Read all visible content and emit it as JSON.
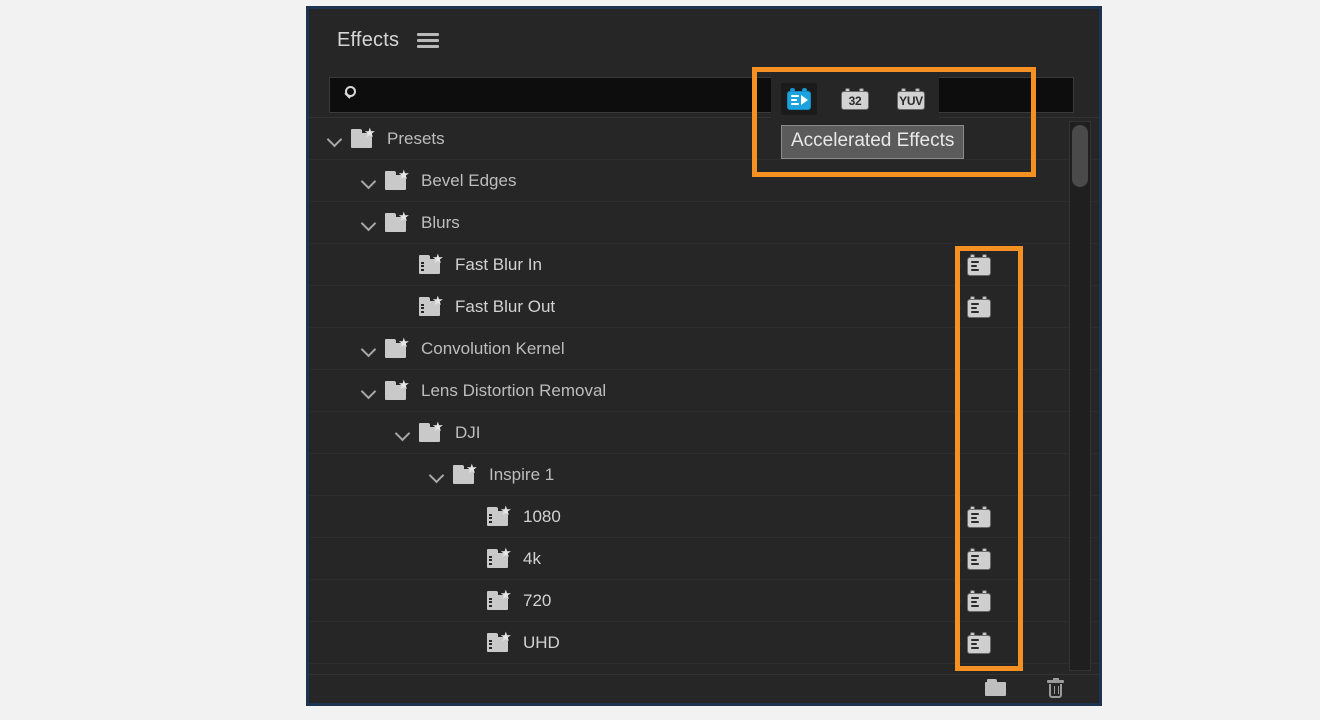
{
  "panel": {
    "title": "Effects",
    "menu_icon": "hamburger-menu-icon"
  },
  "search": {
    "value": "",
    "placeholder": "",
    "icon": "search-icon"
  },
  "filter_toolbar": {
    "buttons": [
      {
        "icon": "accelerated-effects-icon",
        "label": "Accelerated Effects",
        "active": true
      },
      {
        "icon": "32-bit-color-icon",
        "label": "32",
        "active": false
      },
      {
        "icon": "yuv-color-icon",
        "label": "YUV",
        "active": false
      }
    ],
    "tooltip": "Accelerated Effects"
  },
  "tree": {
    "rows": [
      {
        "label": "Presets",
        "depth": 0,
        "type": "folder",
        "expanded": true,
        "accelerated": false
      },
      {
        "label": "Bevel Edges",
        "depth": 1,
        "type": "folder",
        "expanded": true,
        "accelerated": false
      },
      {
        "label": "Blurs",
        "depth": 1,
        "type": "folder",
        "expanded": true,
        "accelerated": false
      },
      {
        "label": "Fast Blur In",
        "depth": 2,
        "type": "preset",
        "expanded": false,
        "accelerated": true
      },
      {
        "label": "Fast Blur Out",
        "depth": 2,
        "type": "preset",
        "expanded": false,
        "accelerated": true
      },
      {
        "label": "Convolution Kernel",
        "depth": 1,
        "type": "folder",
        "expanded": true,
        "accelerated": false
      },
      {
        "label": "Lens Distortion Removal",
        "depth": 1,
        "type": "folder",
        "expanded": true,
        "accelerated": false
      },
      {
        "label": "DJI",
        "depth": 2,
        "type": "folder",
        "expanded": true,
        "accelerated": false
      },
      {
        "label": "Inspire 1",
        "depth": 3,
        "type": "folder",
        "expanded": true,
        "accelerated": false
      },
      {
        "label": "1080",
        "depth": 4,
        "type": "preset",
        "expanded": false,
        "accelerated": true
      },
      {
        "label": "4k",
        "depth": 4,
        "type": "preset",
        "expanded": false,
        "accelerated": true
      },
      {
        "label": "720",
        "depth": 4,
        "type": "preset",
        "expanded": false,
        "accelerated": true
      },
      {
        "label": "UHD",
        "depth": 4,
        "type": "preset",
        "expanded": false,
        "accelerated": true
      }
    ]
  },
  "footer": {
    "new_folder_icon": "new-folder-icon",
    "delete_icon": "trash-icon"
  },
  "scrollbar": {
    "orientation": "vertical"
  },
  "highlights": {
    "accent_color": "#f59123",
    "boxes": [
      {
        "name": "filter-toolbar-highlight"
      },
      {
        "name": "accelerated-badges-highlight"
      }
    ]
  },
  "colors": {
    "panel_background": "#262626",
    "panel_border": "#1d3450",
    "search_background": "#0d0d0d",
    "active_icon_blue": "#1ba3e0",
    "highlight_orange": "#f59123",
    "text": "#bdbdbd"
  }
}
